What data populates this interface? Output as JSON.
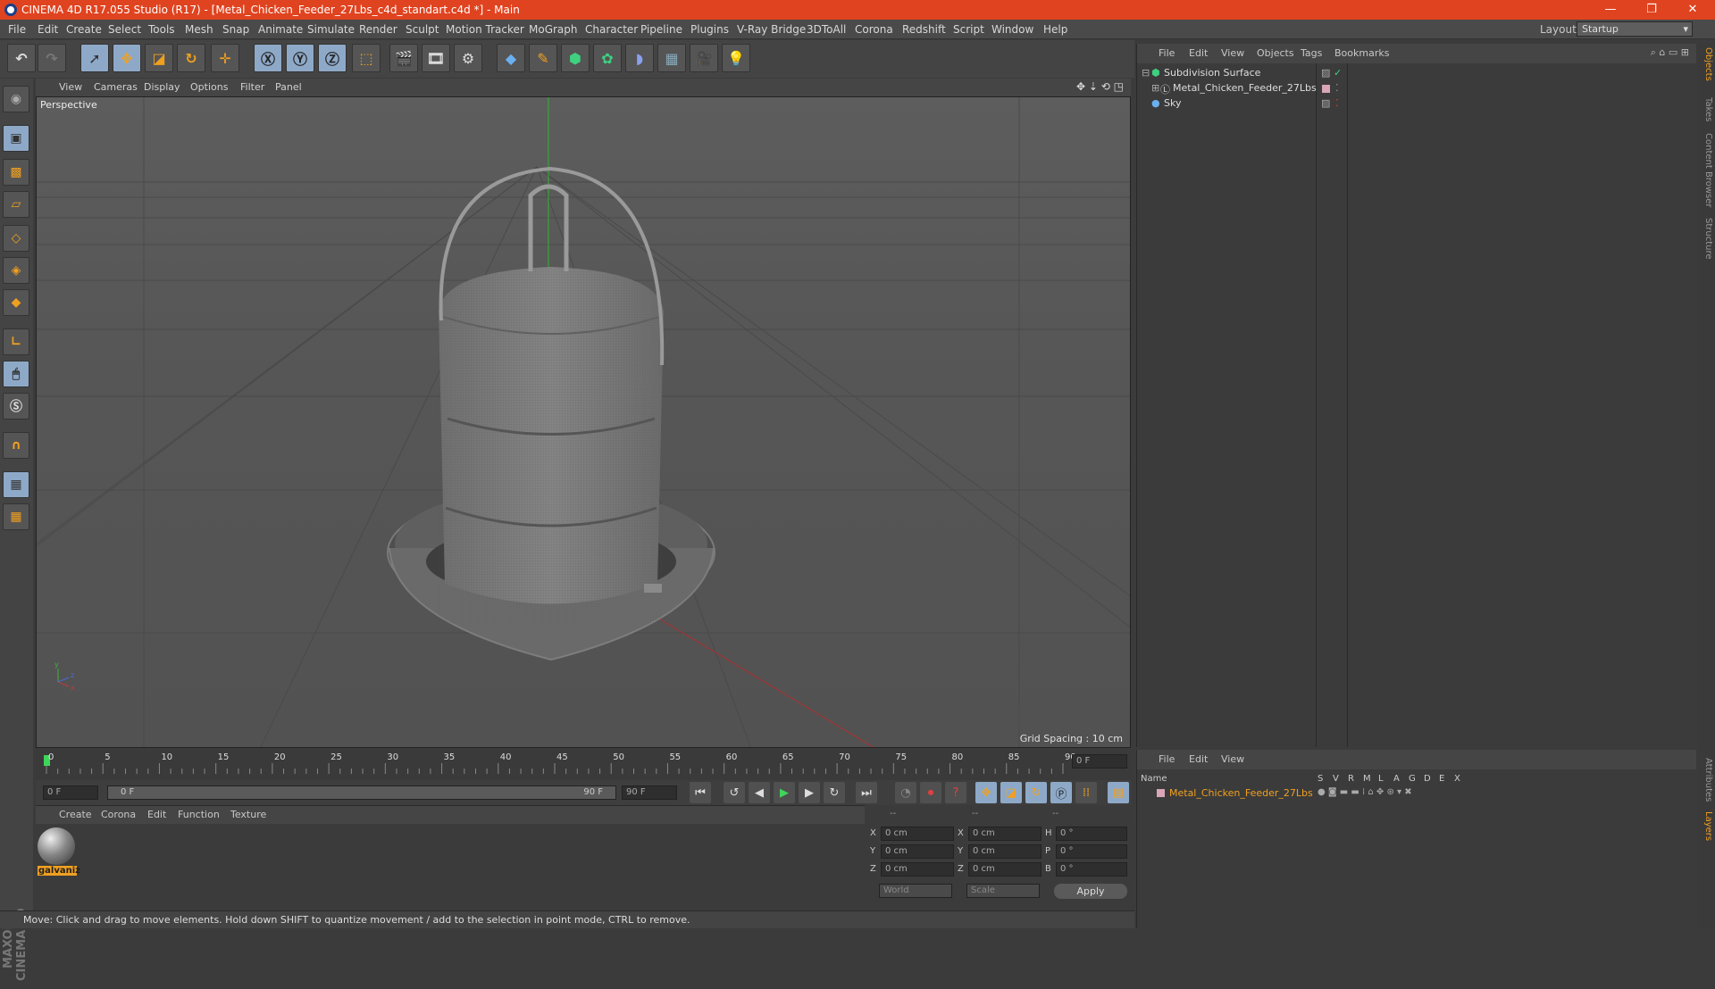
{
  "window": {
    "title": "CINEMA 4D R17.055 Studio (R17) - [Metal_Chicken_Feeder_27Lbs_c4d_standart.c4d *] - Main",
    "controls": [
      "—",
      "❐",
      "✕"
    ]
  },
  "menubar": {
    "items": [
      "File",
      "Edit",
      "Create",
      "Select",
      "Tools",
      "Mesh",
      "Snap",
      "Animate",
      "Simulate",
      "Render",
      "Sculpt",
      "Motion Tracker",
      "MoGraph",
      "Character",
      "Pipeline",
      "Plugins",
      "V-Ray Bridge",
      "3DToAll",
      "Corona",
      "Redshift",
      "Script",
      "Window",
      "Help"
    ],
    "layout_label": "Layout:",
    "layout_value": "Startup"
  },
  "viewport": {
    "menu": [
      "View",
      "Cameras",
      "Display",
      "Options",
      "Filter",
      "Panel"
    ],
    "label": "Perspective",
    "grid_spacing": "Grid Spacing : 10 cm"
  },
  "timeline": {
    "ticks": [
      "0",
      "5",
      "10",
      "15",
      "20",
      "25",
      "30",
      "35",
      "40",
      "45",
      "50",
      "55",
      "60",
      "65",
      "70",
      "75",
      "80",
      "85",
      "90"
    ],
    "end_frame_field": "0 F",
    "start_field": "0 F",
    "range_start": "0 F",
    "range_end": "90 F",
    "max_field": "90 F"
  },
  "materials": {
    "menu": [
      "Create",
      "Corona",
      "Edit",
      "Function",
      "Texture"
    ],
    "items": [
      {
        "name": "galvaniz"
      }
    ]
  },
  "coordinates": {
    "headers": [
      "--",
      "--",
      "--"
    ],
    "rows": [
      {
        "a": "X",
        "av": "0 cm",
        "b": "X",
        "bv": "0 cm",
        "c": "H",
        "cv": "0 °"
      },
      {
        "a": "Y",
        "av": "0 cm",
        "b": "Y",
        "bv": "0 cm",
        "c": "P",
        "cv": "0 °"
      },
      {
        "a": "Z",
        "av": "0 cm",
        "b": "Z",
        "bv": "0 cm",
        "c": "B",
        "cv": "0 °"
      }
    ],
    "mode1": "World",
    "mode2": "Scale",
    "apply": "Apply"
  },
  "statusbar": {
    "text": "Move: Click and drag to move elements. Hold down SHIFT to quantize movement / add to the selection in point mode, CTRL to remove."
  },
  "objects": {
    "menu": [
      "File",
      "Edit",
      "View",
      "Objects",
      "Tags",
      "Bookmarks"
    ],
    "tree": [
      {
        "name": "Subdivision Surface"
      },
      {
        "name": "Metal_Chicken_Feeder_27Lbs"
      },
      {
        "name": "Sky"
      }
    ]
  },
  "layers": {
    "menu": [
      "File",
      "Edit",
      "View"
    ],
    "columns": [
      "Name",
      "S",
      "V",
      "R",
      "M",
      "L",
      "A",
      "G",
      "D",
      "E",
      "X"
    ],
    "rows": [
      {
        "name": "Metal_Chicken_Feeder_27Lbs"
      }
    ]
  },
  "side_tabs": {
    "top": [
      "Objects",
      "Takes",
      "Content Browser",
      "Structure"
    ],
    "bottom": [
      "Attributes",
      "Layers"
    ]
  },
  "colors": {
    "titlebar": "#e0431f",
    "accent_orange": "#f0a020",
    "active_blue": "#8ea9c8"
  }
}
